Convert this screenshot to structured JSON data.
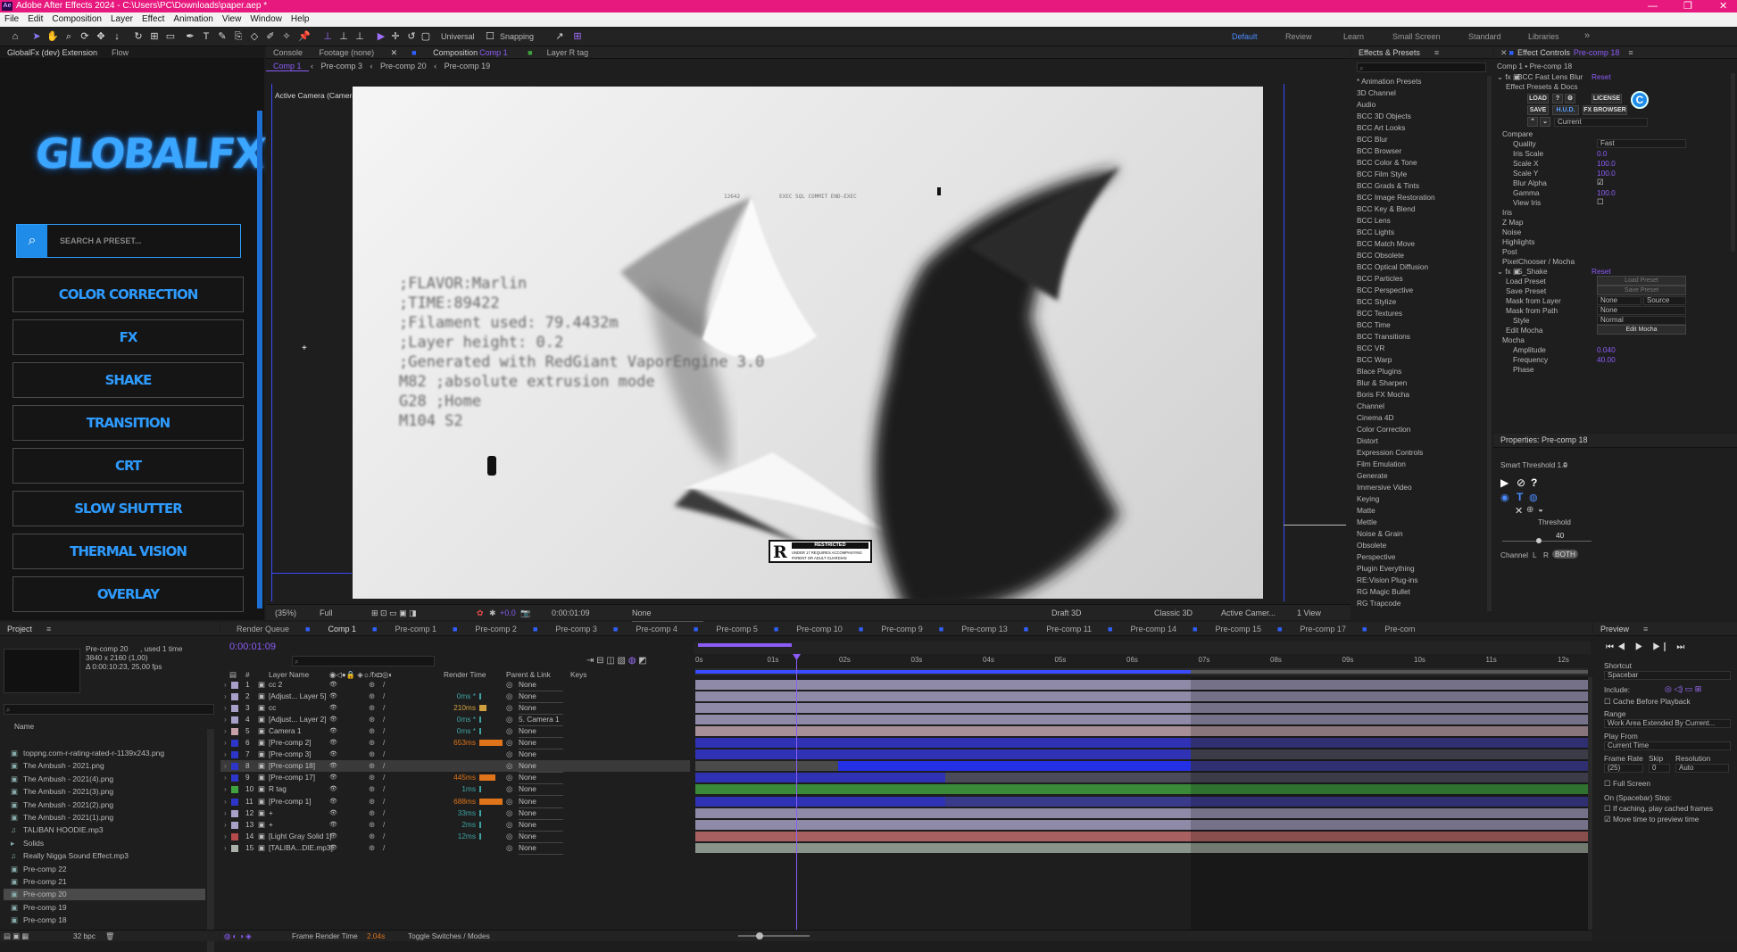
{
  "window": {
    "title": "Adobe After Effects 2024 - C:\\Users\\PC\\Downloads\\paper.aep *",
    "min": "—",
    "max": "❐",
    "close": "✕"
  },
  "menu": [
    "File",
    "Edit",
    "Composition",
    "Layer",
    "Effect",
    "Animation",
    "View",
    "Window",
    "Help"
  ],
  "toolbar": {
    "universal": "Universal",
    "snapping": "Snapping"
  },
  "workspaces": [
    "Default",
    "Review",
    "Learn",
    "Small Screen",
    "Standard",
    "Libraries"
  ],
  "globalfx": {
    "tab": "GlobalFx (dev) Extension",
    "flow": "Flow",
    "logo": "GLOBALFX",
    "search_placeholder": "SEARCH A PRESET...",
    "buttons": [
      "COLOR CORRECTION",
      "FX",
      "SHAKE",
      "TRANSITION",
      "CRT",
      "SLOW SHUTTER",
      "THERMAL VISION",
      "OVERLAY"
    ]
  },
  "viewer": {
    "tabs": [
      "Console",
      "Footage (none)",
      "Composition",
      "Comp 1",
      "Layer R tag"
    ],
    "subtabs": [
      "Comp 1",
      "Pre-comp 3",
      "Pre-comp 20",
      "Pre-comp 19"
    ],
    "camera_label": "Active Camera (Camera 1)",
    "canvas_text": [
      "12642",
      "EXEC SQL COMMIT END-EXEC",
      ";FLAVOR:Marlin",
      ";TIME:89422",
      ";Filament used: 79.4432m",
      ";Layer height: 0.2",
      ";Generated with RedGiant VaporEngine 3.0",
      "M82 ;absolute extrusion mode",
      "G28 ;Home",
      "M104 S2"
    ],
    "rating": {
      "letter": "R",
      "title": "RESTRICTED",
      "line1": "UNDER 17 REQUIRES ACCOMPANYING",
      "line2": "PARENT OR ADULT GUARDIAN"
    },
    "bottom": {
      "zoom": "(35%)",
      "res": "Full",
      "time": "0:00:01:09",
      "channel": "None",
      "draft": "Draft 3D",
      "renderer": "Classic 3D",
      "camera": "Active Camer...",
      "views": "1 View",
      "plus": "+0.0"
    }
  },
  "effects_presets": {
    "title": "Effects & Presets",
    "items": [
      "* Animation Presets",
      "3D Channel",
      "Audio",
      "BCC 3D Objects",
      "BCC Art Looks",
      "BCC Blur",
      "BCC Browser",
      "BCC Color & Tone",
      "BCC Film Style",
      "BCC Grads & Tints",
      "BCC Image Restoration",
      "BCC Key & Blend",
      "BCC Lens",
      "BCC Lights",
      "BCC Match Move",
      "BCC Obsolete",
      "BCC Optical Diffusion",
      "BCC Particles",
      "BCC Perspective",
      "BCC Stylize",
      "BCC Textures",
      "BCC Time",
      "BCC Transitions",
      "BCC VR",
      "BCC Warp",
      "Blace Plugins",
      "Blur & Sharpen",
      "Boris FX Mocha",
      "Channel",
      "Cinema 4D",
      "Color Correction",
      "Distort",
      "Expression Controls",
      "Film Emulation",
      "Generate",
      "Immersive Video",
      "Keying",
      "Matte",
      "Mettle",
      "Noise & Grain",
      "Obsolete",
      "Perspective",
      "Plugin Everything",
      "RE:Vision Plug-ins",
      "RG Magic Bullet",
      "RG Trapcode"
    ]
  },
  "effect_controls": {
    "title": "Effect Controls",
    "comp": "Pre-comp 18",
    "path": "Comp 1 • Pre-comp 18",
    "fx1": "BCC Fast Lens Blur",
    "reset": "Reset",
    "presets_docs": "Effect Presets & Docs",
    "load": "LOAD",
    "license": "LICENSE",
    "save": "SAVE",
    "hud": "H.U.D.",
    "fxbrowser": "FX BROWSER",
    "current": "Current",
    "compare": "Compare",
    "quality": "Quality",
    "quality_val": "Fast",
    "iris_scale": "Iris Scale",
    "iris_scale_val": "0.0",
    "scale_x": "Scale X",
    "scale_x_val": "100.0",
    "scale_y": "Scale Y",
    "scale_y_val": "100.0",
    "blur_alpha": "Blur Alpha",
    "gamma": "Gamma",
    "gamma_val": "100.0",
    "view_iris": "View Iris",
    "iris": "Iris",
    "zmap": "Z Map",
    "noise": "Noise",
    "highlights": "Highlights",
    "post": "Post",
    "pixelchooser": "PixelChooser / Mocha",
    "fx2": "S_Shake",
    "load_preset": "Load Preset",
    "save_preset": "Save Preset",
    "mask_layer": "Mask from Layer",
    "mask_layer_val": "None",
    "mask_layer_val2": "Source",
    "mask_path": "Mask from Path",
    "mask_path_val": "None",
    "style": "Style",
    "style_val": "Normal",
    "edit_mocha": "Edit Mocha",
    "mocha": "Mocha",
    "amplitude": "Amplitude",
    "amplitude_val": "0.040",
    "frequency": "Frequency",
    "frequency_val": "40.00",
    "phase": "Phase"
  },
  "properties": {
    "title": "Properties: Pre-comp 18",
    "smart_threshold": "Smart Threshold 1.0",
    "threshold_label": "Threshold",
    "threshold_val": "40",
    "channel": "Channel",
    "l": "L",
    "r": "R",
    "both": "BOTH"
  },
  "project": {
    "title": "Project",
    "selected": "Pre-comp 20",
    "used": ", used 1 time",
    "dims": "3840 x 2160 (1,00)",
    "duration": "Δ 0:00:10:23, 25,00 fps",
    "name_col": "Name",
    "items": [
      "toppng.com-r-rating-rated-r-1139x243.png",
      "The Ambush - 2021.png",
      "The Ambush - 2021(4).png",
      "The Ambush - 2021(3).png",
      "The Ambush - 2021(2).png",
      "The Ambush - 2021(1).png",
      "TALIBAN HOODIE.mp3",
      "Solids",
      "Really Nigga Sound Effect.mp3",
      "Pre-comp 22",
      "Pre-comp 21",
      "Pre-comp 20",
      "Pre-comp 19",
      "Pre-comp 18"
    ],
    "bpc": "32 bpc"
  },
  "timeline": {
    "tabs": [
      "Render Queue",
      "Comp 1",
      "Pre-comp 1",
      "Pre-comp 2",
      "Pre-comp 3",
      "Pre-comp 4",
      "Pre-comp 5",
      "Pre-comp 10",
      "Pre-comp 9",
      "Pre-comp 13",
      "Pre-comp 11",
      "Pre-comp 14",
      "Pre-comp 15",
      "Pre-comp 17",
      "Pre-com"
    ],
    "timecode": "0:00:01:09",
    "cols": {
      "num": "#",
      "layer": "Layer Name",
      "render": "Render Time",
      "parent": "Parent & Link",
      "keys": "Keys"
    },
    "ruler": [
      "0s",
      "01s",
      "02s",
      "03s",
      "04s",
      "05s",
      "06s",
      "07s",
      "08s",
      "09s",
      "10s",
      "11s",
      "12s"
    ],
    "layers": [
      {
        "n": "1",
        "name": "cc 2",
        "color": "#a8a0c8",
        "rt": "",
        "parent": "None"
      },
      {
        "n": "2",
        "name": "[Adjust... Layer 5]",
        "color": "#a8a0c8",
        "rt": "0ms *",
        "parent": "None"
      },
      {
        "n": "3",
        "name": "cc",
        "color": "#a8a0c8",
        "rt": "210ms",
        "parent": "None"
      },
      {
        "n": "4",
        "name": "[Adjust... Layer 2]",
        "color": "#a8a0c8",
        "rt": "0ms *",
        "parent": "5. Camera 1"
      },
      {
        "n": "5",
        "name": "Camera 1",
        "color": "#c8a0a8",
        "rt": "0ms *",
        "parent": "None"
      },
      {
        "n": "6",
        "name": "[Pre-comp 2]",
        "color": "#2d36c8",
        "rt": "653ms",
        "parent": "None"
      },
      {
        "n": "7",
        "name": "[Pre-comp 3]",
        "color": "#2d36c8",
        "rt": "",
        "parent": "None"
      },
      {
        "n": "8",
        "name": "[Pre-comp 18]",
        "color": "#2d36c8",
        "rt": "",
        "parent": "None"
      },
      {
        "n": "9",
        "name": "[Pre-comp 17]",
        "color": "#2d36c8",
        "rt": "445ms",
        "parent": "None"
      },
      {
        "n": "10",
        "name": "R tag",
        "color": "#3fa33f",
        "rt": "1ms",
        "parent": "None"
      },
      {
        "n": "11",
        "name": "[Pre-comp 1]",
        "color": "#2d36c8",
        "rt": "688ms",
        "parent": "None"
      },
      {
        "n": "12",
        "name": "+",
        "color": "#a8a0c8",
        "rt": "33ms",
        "parent": "None"
      },
      {
        "n": "13",
        "name": "+",
        "color": "#a8a0c8",
        "rt": "2ms",
        "parent": "None"
      },
      {
        "n": "14",
        "name": "[Light Gray Solid 1]",
        "color": "#b44a4a",
        "rt": "12ms",
        "parent": "None"
      },
      {
        "n": "15",
        "name": "[TALIBA...DIE.mp3]",
        "color": "#a8b0a8",
        "rt": "",
        "parent": "None"
      }
    ],
    "footer": {
      "frt": "Frame Render Time",
      "frt_val": "2.04s",
      "toggle": "Toggle Switches / Modes"
    }
  },
  "preview": {
    "title": "Preview",
    "shortcut": "Shortcut",
    "shortcut_val": "Spacebar",
    "include": "Include:",
    "cache": "Cache Before Playback",
    "range": "Range",
    "range_val": "Work Area Extended By Current...",
    "play_from": "Play From",
    "play_from_val": "Current Time",
    "frame_rate": "Frame Rate",
    "skip": "Skip",
    "resolution": "Resolution",
    "fr_val": "(25)",
    "skip_val": "0",
    "res_val": "Auto",
    "full_screen": "Full Screen",
    "on_stop": "On (Spacebar) Stop:",
    "if_caching": "If caching, play cached frames",
    "move_time": "Move time to preview time"
  }
}
